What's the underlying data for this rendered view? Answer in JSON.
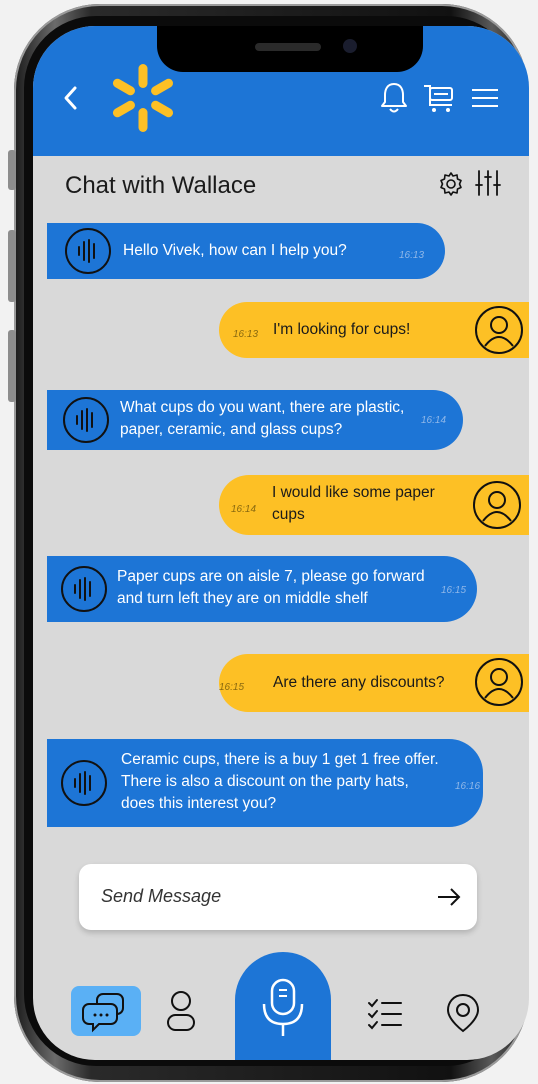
{
  "header": {
    "brand": "Walmart spark logo",
    "icons": [
      "back-chevron-icon",
      "bell-icon",
      "cart-icon",
      "menu-icon"
    ]
  },
  "chat": {
    "title": "Chat with Wallace",
    "messages": [
      {
        "from": "bot",
        "text": "Hello Vivek, how can I help you?",
        "time": "16:13"
      },
      {
        "from": "user",
        "text": "I'm looking for cups!",
        "time": "16:13"
      },
      {
        "from": "bot",
        "text": "What cups do you want, there are plastic, paper, ceramic, and glass cups?",
        "time": "16:14"
      },
      {
        "from": "user",
        "text": "I would like some paper cups",
        "time": "16:14"
      },
      {
        "from": "bot",
        "text": "Paper cups are on aisle 7, please go forward and turn left they are on middle shelf",
        "time": "16:15"
      },
      {
        "from": "user",
        "text": "Are there any discounts?",
        "time": "16:15"
      },
      {
        "from": "bot",
        "text": "Ceramic cups, there is a buy 1 get 1 free offer. There is also a discount on the party hats, does this interest you?",
        "time": "16:16"
      }
    ]
  },
  "composer": {
    "placeholder": "Send Message"
  },
  "nav": {
    "active": "chat",
    "items": [
      "chat",
      "profile",
      "voice",
      "list",
      "location"
    ]
  },
  "colors": {
    "primary": "#1d75d6",
    "accent": "#fdc025",
    "background": "#d9d9d9"
  }
}
